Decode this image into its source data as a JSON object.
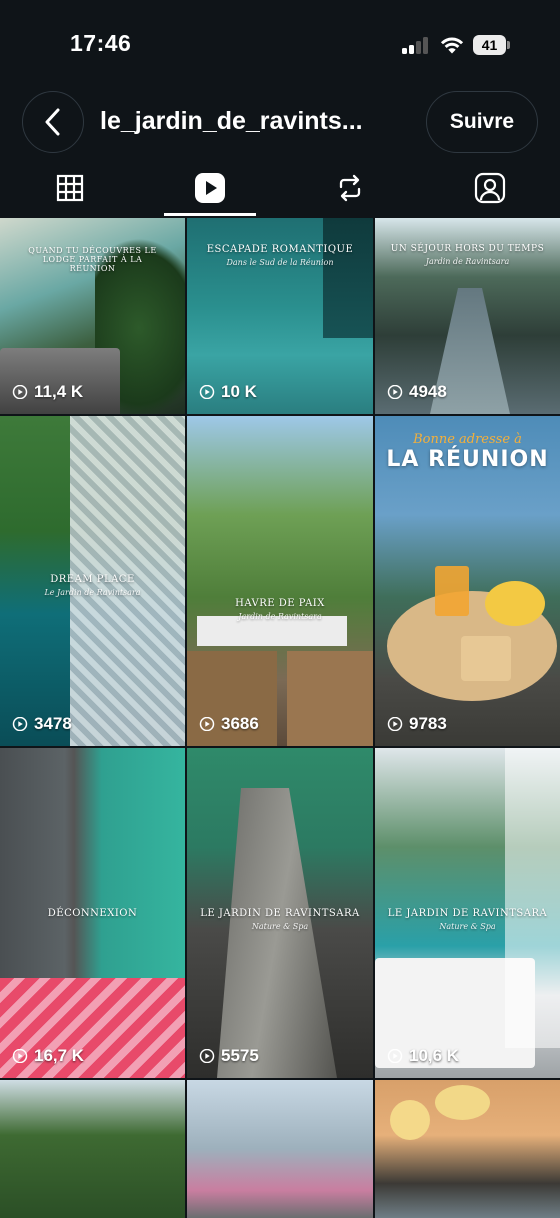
{
  "status_bar": {
    "time": "17:46",
    "battery": "41"
  },
  "header": {
    "username": "le_jardin_de_ravints...",
    "follow_label": "Suivre"
  },
  "tabs": [
    {
      "icon": "grid-icon",
      "active": false
    },
    {
      "icon": "reels-icon",
      "active": true
    },
    {
      "icon": "repost-icon",
      "active": false
    },
    {
      "icon": "tagged-icon",
      "active": false
    }
  ],
  "posts": [
    {
      "views": "11,4 K",
      "line1": "QUAND TU DÉCOUVRES LE LODGE PARFAIT À LA RÉUNION",
      "line2": ""
    },
    {
      "views": "10 K",
      "line1": "ESCAPADE ROMANTIQUE",
      "line2": "Dans le Sud de la Réunion"
    },
    {
      "views": "4948",
      "line1": "UN SÉJOUR HORS DU TEMPS",
      "line2": "Jardin de Ravintsara"
    },
    {
      "views": "3478",
      "line1": "DREAM PLACE",
      "line2": "Le Jardin de Ravintsara"
    },
    {
      "views": "3686",
      "line1": "HAVRE DE PAIX",
      "line2": "Jardin de Ravintsara"
    },
    {
      "views": "9783",
      "line1": "Bonne adresse à",
      "line2": "LA RÉUNION"
    },
    {
      "views": "16,7 K",
      "line1": "DÉCONNEXION",
      "line2": ""
    },
    {
      "views": "5575",
      "line1": "LE JARDIN DE RAVINTSARA",
      "line2": "Nature & Spa"
    },
    {
      "views": "10,6 K",
      "line1": "LE JARDIN DE RAVINTSARA",
      "line2": "Nature & Spa"
    },
    {
      "views": "",
      "line1": "",
      "line2": ""
    },
    {
      "views": "",
      "line1": "",
      "line2": ""
    },
    {
      "views": "",
      "line1": "",
      "line2": ""
    }
  ]
}
